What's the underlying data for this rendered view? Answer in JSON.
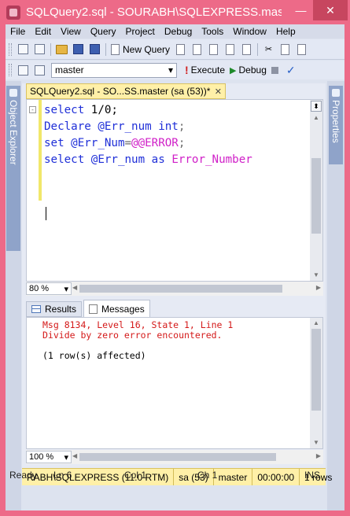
{
  "window": {
    "title": "SQLQuery2.sql - SOURABH\\SQLEXPRESS.master (sa (53))*",
    "title_display": "SQLQuery2.sql - SOURABH\\SQLEXPRESS.mas",
    "minimize_symbol": "—",
    "close_symbol": "✕"
  },
  "menu": [
    "File",
    "Edit",
    "View",
    "Query",
    "Project",
    "Debug",
    "Tools",
    "Window",
    "Help"
  ],
  "toolbar": {
    "new_query_label": "New Query",
    "database": "master",
    "execute_label": "Execute",
    "debug_label": "Debug"
  },
  "side_panels": {
    "left": "Object Explorer",
    "right": "Properties"
  },
  "document_tab": {
    "label": "SQLQuery2.sql - SO...SS.master (sa (53))*",
    "close_symbol": "✕"
  },
  "editor": {
    "lines": [
      [
        {
          "t": "select",
          "c": "kw"
        },
        {
          "t": " 1/0;",
          "c": "tx"
        }
      ],
      [
        {
          "t": "Declare",
          "c": "kw"
        },
        {
          "t": " @Err_num ",
          "c": "vr"
        },
        {
          "t": "int",
          "c": "kw"
        },
        {
          "t": ";",
          "c": "op"
        }
      ],
      [
        {
          "t": "set",
          "c": "kw"
        },
        {
          "t": " @Err_Num",
          "c": "vr"
        },
        {
          "t": "=",
          "c": "op"
        },
        {
          "t": "@@ERROR",
          "c": "fn"
        },
        {
          "t": ";",
          "c": "op"
        }
      ],
      [
        {
          "t": "select",
          "c": "kw"
        },
        {
          "t": " @Err_num ",
          "c": "vr"
        },
        {
          "t": "as",
          "c": "kw"
        },
        {
          "t": " ",
          "c": "tx"
        },
        {
          "t": "Error_Number",
          "c": "fn"
        }
      ]
    ],
    "zoom": "80 %"
  },
  "results": {
    "tabs": [
      {
        "label": "Results",
        "active": false
      },
      {
        "label": "Messages",
        "active": true
      }
    ],
    "messages": [
      {
        "text": "Msg 8134, Level 16, State 1, Line 1",
        "error": true
      },
      {
        "text": "Divide by zero error encountered.",
        "error": true
      },
      {
        "text": "",
        "error": false
      },
      {
        "text": "(1 row(s) affected)",
        "error": false
      }
    ],
    "zoom": "100 %"
  },
  "query_status": {
    "server": "RABH\\SQLEXPRESS (11.0 RTM)",
    "user": "sa (53)",
    "database": "master",
    "elapsed": "00:00:00",
    "rows": "1 rows"
  },
  "status_bar": {
    "state": "Ready",
    "line": "Ln 6",
    "col": "Col 1",
    "ch": "Ch 1",
    "mode": "INS"
  },
  "colors": {
    "window_accent": "#ed6a88",
    "keyword": "#1f2fd8",
    "function": "#d020c8",
    "error_text": "#d41919",
    "status_yellow": "#fff0a8"
  }
}
